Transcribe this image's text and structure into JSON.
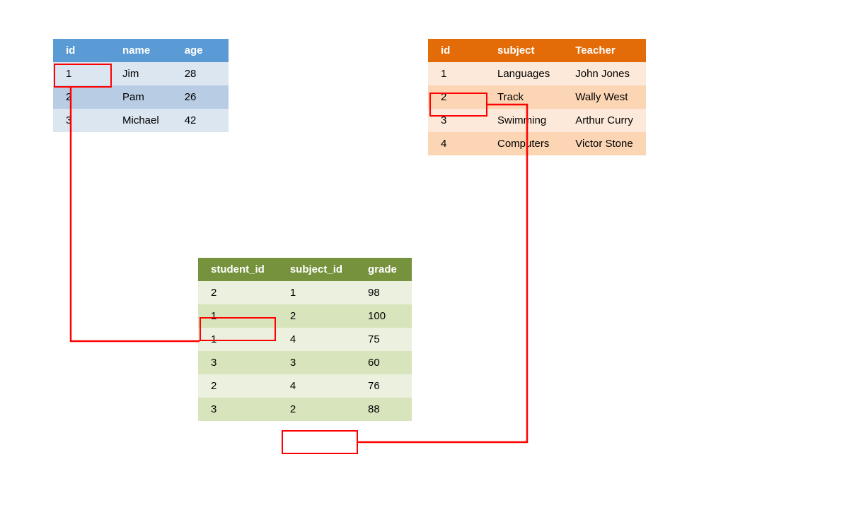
{
  "students_table": {
    "headers": [
      "id",
      "name",
      "age"
    ],
    "rows": [
      {
        "id": "1",
        "name": "Jim",
        "age": "28"
      },
      {
        "id": "2",
        "name": "Pam",
        "age": "26"
      },
      {
        "id": "3",
        "name": "Michael",
        "age": "42"
      }
    ]
  },
  "subjects_table": {
    "headers": [
      "id",
      "subject",
      "Teacher"
    ],
    "rows": [
      {
        "id": "1",
        "subject": "Languages",
        "teacher": "John Jones"
      },
      {
        "id": "2",
        "subject": "Track",
        "teacher": "Wally West"
      },
      {
        "id": "3",
        "subject": "Swimming",
        "teacher": "Arthur Curry"
      },
      {
        "id": "4",
        "subject": "Computers",
        "teacher": "Victor Stone"
      }
    ]
  },
  "grades_table": {
    "headers": [
      "student_id",
      "subject_id",
      "grade"
    ],
    "rows": [
      {
        "student_id": "2",
        "subject_id": "1",
        "grade": "98"
      },
      {
        "student_id": "1",
        "subject_id": "2",
        "grade": "100"
      },
      {
        "student_id": "1",
        "subject_id": "4",
        "grade": "75"
      },
      {
        "student_id": "3",
        "subject_id": "3",
        "grade": "60"
      },
      {
        "student_id": "2",
        "subject_id": "4",
        "grade": "76"
      },
      {
        "student_id": "3",
        "subject_id": "2",
        "grade": "88"
      }
    ]
  }
}
